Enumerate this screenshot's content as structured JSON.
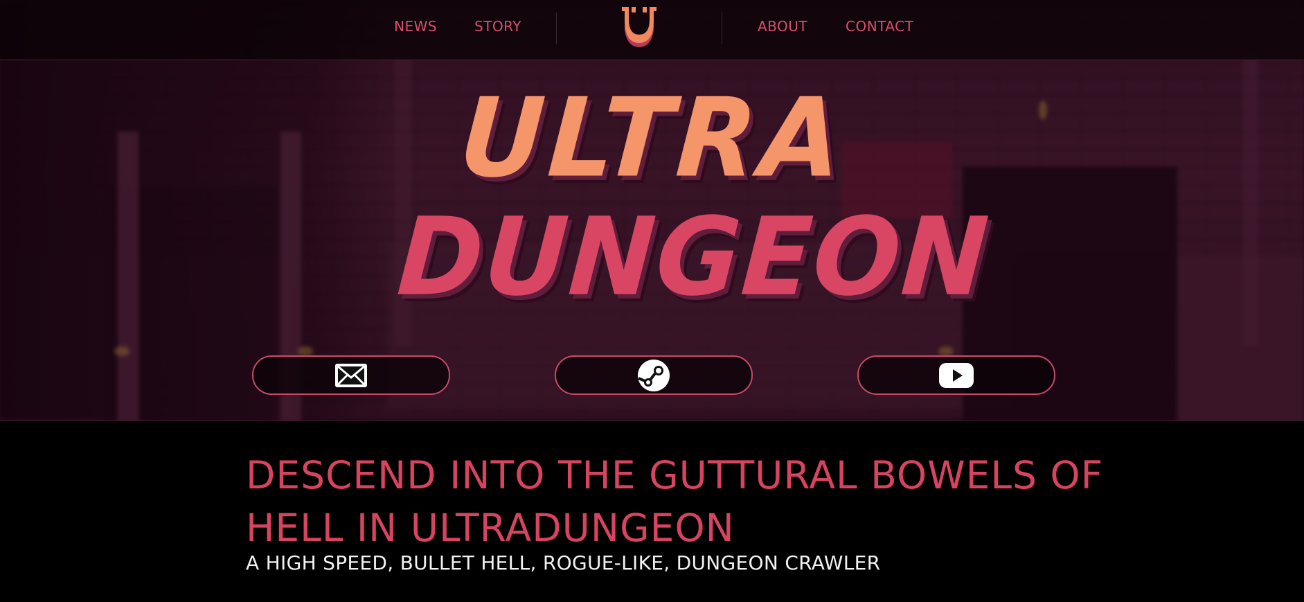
{
  "nav": {
    "links_left": [
      "NEWS",
      "STORY"
    ],
    "links_right": [
      "ABOUT",
      "CONTACT"
    ],
    "logo_icon": "horseshoe-logo-icon"
  },
  "hero": {
    "title_line1": "ULTRA",
    "title_line2": "DUNGEON",
    "buttons": [
      {
        "icon": "mail-icon"
      },
      {
        "icon": "steam-icon"
      },
      {
        "icon": "youtube-icon"
      }
    ]
  },
  "intro": {
    "headline": "DESCEND INTO THE GUTTURAL BOWELS OF HELL IN ULTRADUNGEON",
    "tagline": "A HIGH SPEED, BULLET HELL, ROGUE-LIKE, DUNGEON CRAWLER"
  },
  "colors": {
    "accent": "#d6445f",
    "title_orange": "#f5956a",
    "title_pink": "#d94664",
    "background": "#000000"
  }
}
